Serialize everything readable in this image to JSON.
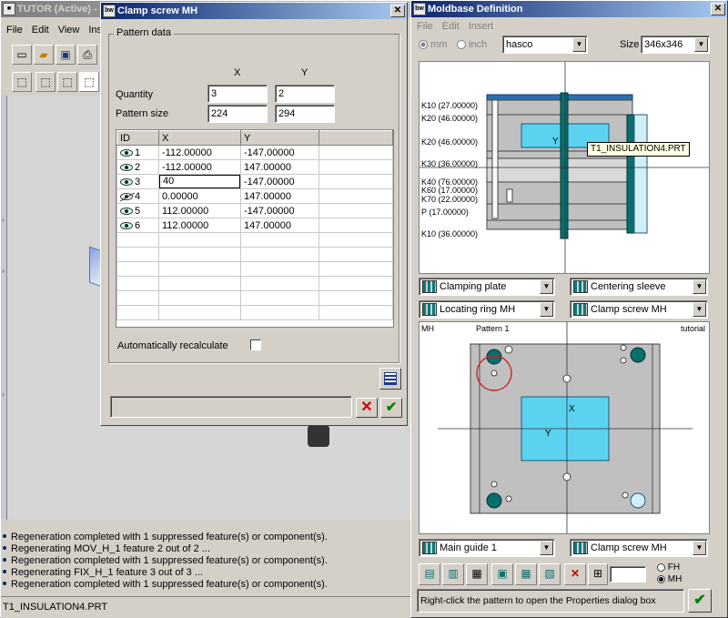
{
  "tutor": {
    "title": "TUTOR (Active) - P",
    "menu": [
      "File",
      "Edit",
      "View",
      "Inse"
    ],
    "status_file": "T1_INSULATION4.PRT",
    "log": [
      "Regeneration completed with 1 suppressed feature(s) or component(s).",
      "Regenerating MOV_H_1 feature 2 out of 2 ...",
      "Regeneration completed with 1 suppressed feature(s) or component(s).",
      "Regenerating FIX_H_1 feature 3 out of 3 ...",
      "Regeneration completed with 1 suppressed feature(s) or component(s)."
    ]
  },
  "clamp": {
    "icon": "bw",
    "title": "Clamp screw MH",
    "group_label": "Pattern data",
    "col_x": "X",
    "col_y": "Y",
    "quantity_label": "Quantity",
    "quantity_x": "3",
    "quantity_y": "2",
    "size_label": "Pattern size",
    "size_x": "224",
    "size_y": "294",
    "table_headers": [
      "ID",
      "X",
      "Y"
    ],
    "rows": [
      {
        "id": "1",
        "x": "-112.00000",
        "y": "-147.00000",
        "visible": true
      },
      {
        "id": "2",
        "x": "-112.00000",
        "y": "147.00000",
        "visible": true
      },
      {
        "id": "3",
        "x": "40",
        "y": "-147.00000",
        "visible": true,
        "editing": true
      },
      {
        "id": "4",
        "x": "0.00000",
        "y": "147.00000",
        "visible": false
      },
      {
        "id": "5",
        "x": "112.00000",
        "y": "-147.00000",
        "visible": true
      },
      {
        "id": "6",
        "x": "112.00000",
        "y": "147.00000",
        "visible": true
      }
    ],
    "auto_recalc_label": "Automatically recalculate",
    "auto_recalc_checked": false
  },
  "moldbase": {
    "icon": "bw",
    "title": "Moldbase Definition",
    "menu": [
      "File",
      "Edit",
      "Insert"
    ],
    "unit_mm": "mm",
    "unit_inch": "inch",
    "unit_selected": "mm",
    "catalog": "hasco",
    "size_label": "Size",
    "size_value": "346x346",
    "section_labels": [
      {
        "text": "K10 (27.00000)"
      },
      {
        "text": "K20 (46.00000)"
      },
      {
        "text": "K20 (46.00000)"
      },
      {
        "text": "K30 (36.00000)"
      },
      {
        "text": "K40 (76.00000)"
      },
      {
        "text": "K60 (17.00000)"
      },
      {
        "text": "K70 (22.00000)"
      },
      {
        "text": "P (17.00000)"
      },
      {
        "text": "K10 (36.00000)"
      }
    ],
    "section_y_marker": "Y",
    "tooltip": "T1_INSULATION4.PRT",
    "combo_left_1": "Clamping plate",
    "combo_right_1": "Centering sleeve",
    "combo_left_2": "Locating ring MH",
    "combo_right_2": "Clamp screw MH",
    "plan_left": "MH",
    "plan_center": "Pattern 1",
    "plan_right": "tutorial",
    "plan_x_marker": "X",
    "plan_y_marker": "Y",
    "combo_left_3": "Main guide 1",
    "combo_right_3": "Clamp screw MH",
    "radio_fh": "FH",
    "radio_mh": "MH",
    "hint": "Right-click the pattern to open the Properties dialog box",
    "colors": {
      "teal": "#0a6e6e",
      "cyan": "#5bd2f0",
      "plate": "#c0c0c0"
    }
  }
}
